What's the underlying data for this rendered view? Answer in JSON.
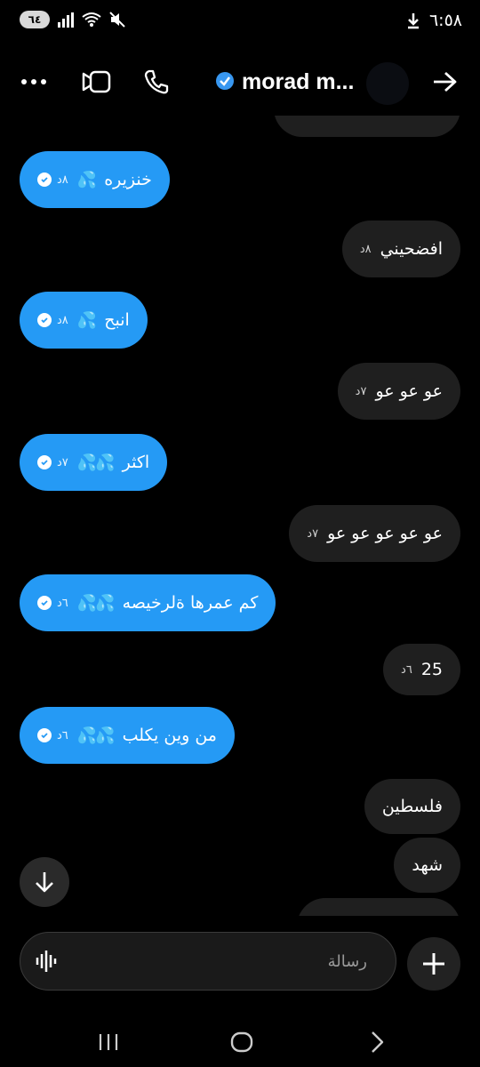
{
  "status_bar": {
    "battery": "٦٤",
    "time": "٦:٥٨",
    "icons": [
      "signal-icon",
      "wifi-icon",
      "mute-icon",
      "download-icon"
    ]
  },
  "header": {
    "name": "morad m...",
    "verified": true,
    "icons": [
      "more-icon",
      "video-icon",
      "phone-icon",
      "verified-icon",
      "back-arrow-icon"
    ]
  },
  "messages": [
    {
      "side": "sent",
      "text": "خنزيره",
      "drops": "💦",
      "time": "٨د",
      "read": true
    },
    {
      "side": "recv",
      "text": "افضحيني",
      "time": "٨د"
    },
    {
      "side": "sent",
      "text": "انبح",
      "drops": "💦",
      "time": "٨د",
      "read": true
    },
    {
      "side": "recv",
      "text": "عو عو عو",
      "time": "٧د"
    },
    {
      "side": "sent",
      "text": "اكثر",
      "drops": "💦💦",
      "time": "٧د",
      "read": true
    },
    {
      "side": "recv",
      "text": "عو عو عو عو عو",
      "time": "٧د"
    },
    {
      "side": "sent",
      "text": "كم عمرها ةلرخيصه",
      "drops": "💦💦",
      "time": "٦د",
      "read": true
    },
    {
      "side": "recv",
      "text": "25",
      "time": "٦د"
    },
    {
      "side": "sent",
      "text": "من وين يكلب",
      "drops": "💦💦",
      "time": "٦د",
      "read": true
    },
    {
      "side": "recv",
      "text": "فلسطين",
      "time": ""
    },
    {
      "side": "recv",
      "text": "شهد",
      "time": ""
    }
  ],
  "composer": {
    "placeholder": "رسالة"
  },
  "colors": {
    "sent_bubble": "#259af5",
    "recv_bubble": "#1f1f1f",
    "background": "#000000",
    "verified": "#3897f0"
  }
}
